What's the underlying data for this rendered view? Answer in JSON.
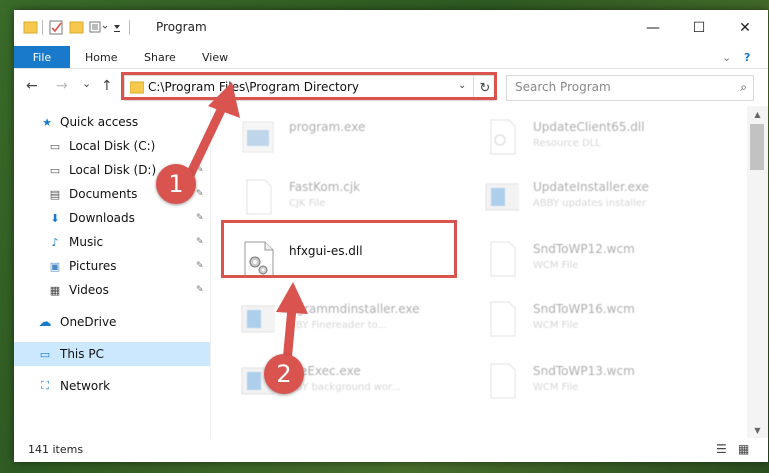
{
  "window": {
    "title": "Program",
    "minimize": "—",
    "maximize": "☐",
    "close": "✕"
  },
  "ribbon": {
    "file": "File",
    "home": "Home",
    "share": "Share",
    "view": "View",
    "help": "?"
  },
  "nav": {
    "back": "←",
    "forward": "→",
    "down": "⌄",
    "up": "↑"
  },
  "address": {
    "path": "C:\\Program Files\\Program Directory",
    "chevron": "⌄",
    "refresh": "↻"
  },
  "search": {
    "placeholder": "Search Program",
    "icon": "⌕"
  },
  "sidebar": {
    "items": [
      {
        "label": "Quick access",
        "icon": "★"
      },
      {
        "label": "Local Disk (C:)",
        "icon": "▭"
      },
      {
        "label": "Local Disk (D:)",
        "icon": "▭"
      },
      {
        "label": "Documents",
        "icon": "▤"
      },
      {
        "label": "Downloads",
        "icon": "⬇"
      },
      {
        "label": "Music",
        "icon": "♪"
      },
      {
        "label": "Pictures",
        "icon": "▣"
      },
      {
        "label": "Videos",
        "icon": "▦"
      },
      {
        "label": "OneDrive",
        "icon": "☁"
      },
      {
        "label": "This PC",
        "icon": "▭"
      },
      {
        "label": "Network",
        "icon": "⛶"
      }
    ],
    "pin": "📌"
  },
  "files": {
    "f1": {
      "name": "program.exe",
      "type": ""
    },
    "f2": {
      "name": "UpdateClient65.dll",
      "type": "Resource DLL"
    },
    "f3": {
      "name": "FastKom.cjk",
      "type": "CJK File"
    },
    "f4": {
      "name": "UpdateInstaller.exe",
      "type": "ABBY updates installer"
    },
    "f5": {
      "name": "hfxgui-es.dll",
      "type": ""
    },
    "f6": {
      "name": "SndToWP12.wcm",
      "type": "WCM File"
    },
    "f7": {
      "name": "ogrammdinstaller.exe",
      "type": "BBY Finereader to..."
    },
    "f8": {
      "name": "SndToWP16.wcm",
      "type": "WCM File"
    },
    "f9": {
      "name": "ineExec.exe",
      "type": "BBY background wor..."
    },
    "f10": {
      "name": "SndToWP13.wcm",
      "type": "WCM File"
    }
  },
  "status": {
    "count": "141 items"
  },
  "callouts": {
    "one": "1",
    "two": "2"
  },
  "colors": {
    "accent": "#1979ca",
    "highlight": "#d9534f",
    "selected": "#cce8ff"
  }
}
